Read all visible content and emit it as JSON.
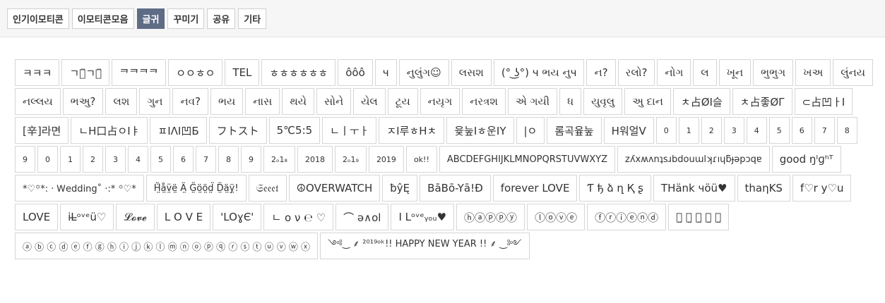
{
  "tabs": [
    {
      "label": "인기이모티콘",
      "active": false
    },
    {
      "label": "이모티콘모음",
      "active": false
    },
    {
      "label": "글귀",
      "active": true
    },
    {
      "label": "꾸미기",
      "active": false
    },
    {
      "label": "공유",
      "active": false
    },
    {
      "label": "기타",
      "active": false
    }
  ],
  "items": [
    "ㅋㅋㅋ",
    "ㄱㄱ̈ㄱㄱ̈",
    "ᄏᄏᄏᄏ",
    "ㅇㅇㅎㅇ",
    "TEL",
    "ㅎㅎㅎㅎㅎㅎ",
    "ôôô",
    "ч",
    "નુલુંગ☺",
    "લસશ",
    "(° ͜ʖ°) ч ભય નુч",
    "ન?",
    "રલો?",
    "નોગ",
    "લ",
    "ખૂન",
    "ભુભુગ",
    "ખઅ",
    "લુંનય",
    "નલ્લય",
    "ભઅુ?",
    "લશ",
    "ગુન",
    "નવ?",
    "ભય",
    "નાસ",
    "થયે",
    "સોને",
    "યેલ",
    "ટૂય",
    "નયૃગ",
    "નરત્રશ",
    "એ ગયી",
    "ધ",
    "યુવૃલુ",
    "અુ દાન",
    "ㅊ占ØI슬",
    "ㅊ占좋ØΓ",
    "⊂占凹ㅏI",
    "[辛]라면",
    "ㄴH口占ㅇIㅑ",
    "ㅍIΛI凹Б",
    "フトスト",
    "5℃5:5",
    "ㄴㅣㅜㅏ",
    "ㅈI루ㅎHㅊ",
    "윷눞Iㅎ운IY",
    "|ㅇ",
    "롬곡윺눞",
    "H워얼V",
    "0",
    "1",
    "2",
    "3",
    "4",
    "5",
    "6",
    "7",
    "8",
    "9",
    "0",
    "1",
    "2",
    "3",
    "4",
    "5",
    "6",
    "7",
    "8",
    "9",
    "2ₒ1₈",
    "2018",
    "2ₒ1₉",
    "2019",
    "ok!!",
    "ABCDEFGHIJKLMNOPQRSTUVWXYZ",
    "zʎxʍʌnʇsɹbdouɯlʞɾıɥƃɟǝpɔqɐ",
    "good ŋᴵɡʰᵀ",
    "*♡꙳*: · Ꮃedding˚ ·:* ꙳♡*",
    "Ḧ̤̈å̤v̤̈ë̤ Ä̤ G̤̈ö̤ö̤d̤̈ D̤̈ä̤ÿ̤!",
    "𝔖𝔢𝔢𝔢𝔱",
    "☮OVERWATCH",
    "ƀŷĘ",
    "BāBō-Yā!Đ",
    "forever LOVE",
    "Ƭ ђ ձ ղ Қ ʂ",
    "THänk чöü♥",
    "thaηKS",
    "f♡r y♡u",
    "LOVE",
    "iL̶ᵒᵛᵉü♡",
    "𝓛𝓸𝓿𝓮",
    "L O V E",
    "'LOɣЄ'",
    "ㄴ o ν ℮ ♡",
    "⌒ ə∧ol",
    "I Lᵒᵛᵉᵧₒᵤ♥",
    "ⓗⓐⓟⓟⓨ",
    "ⓛⓞⓥⓔ",
    "ⓕⓡⓘⓔⓝⓓ",
    "ⓗ̤ ⓐ̤ ⓟ̤ ⓨ̤ ⓔ̤",
    "ⓐ ⓑ ⓒ ⓓ ⓔ ⓕ ⓖ ⓗ ⓘ ⓙ ⓚ ⓛ ⓜ ⓝ ⓞ ⓟ ⓠ ⓡ ⓢ ⓣ ⓤ ⓥ ⓦ ⓧ",
    "༺‿ ⸙ ²⁰¹⁹ᵒᵏ!! HAPPY NEW YEAR !! ⸙ ‿༻"
  ]
}
